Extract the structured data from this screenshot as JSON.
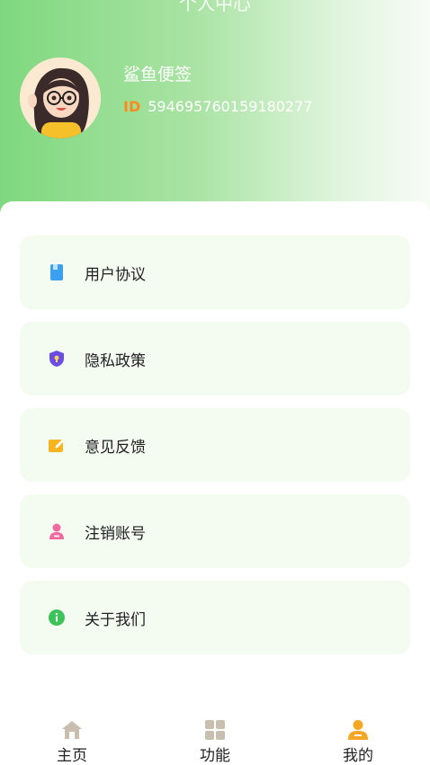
{
  "header": {
    "title": "个人中心",
    "nickname": "鲨鱼便签",
    "id_label": "ID",
    "id_value": "594695760159180277"
  },
  "menu": [
    {
      "label": "用户协议",
      "icon": "book-icon",
      "color": "#3ba0f0"
    },
    {
      "label": "隐私政策",
      "icon": "shield-icon",
      "color": "#6b4de6"
    },
    {
      "label": "意见反馈",
      "icon": "edit-note-icon",
      "color": "#f5b521"
    },
    {
      "label": "注销账号",
      "icon": "user-remove-icon",
      "color": "#f06aa0"
    },
    {
      "label": "关于我们",
      "icon": "info-icon",
      "color": "#3cc45a"
    }
  ],
  "tabs": [
    {
      "label": "主页",
      "icon": "home-icon"
    },
    {
      "label": "功能",
      "icon": "grid-icon"
    },
    {
      "label": "我的",
      "icon": "profile-icon",
      "active": true
    }
  ],
  "colors": {
    "accent_green": "#7fd87f",
    "id_orange": "#ff8a1e",
    "active_tab": "#f5a623",
    "inactive_tab": "#c8bfb0"
  }
}
